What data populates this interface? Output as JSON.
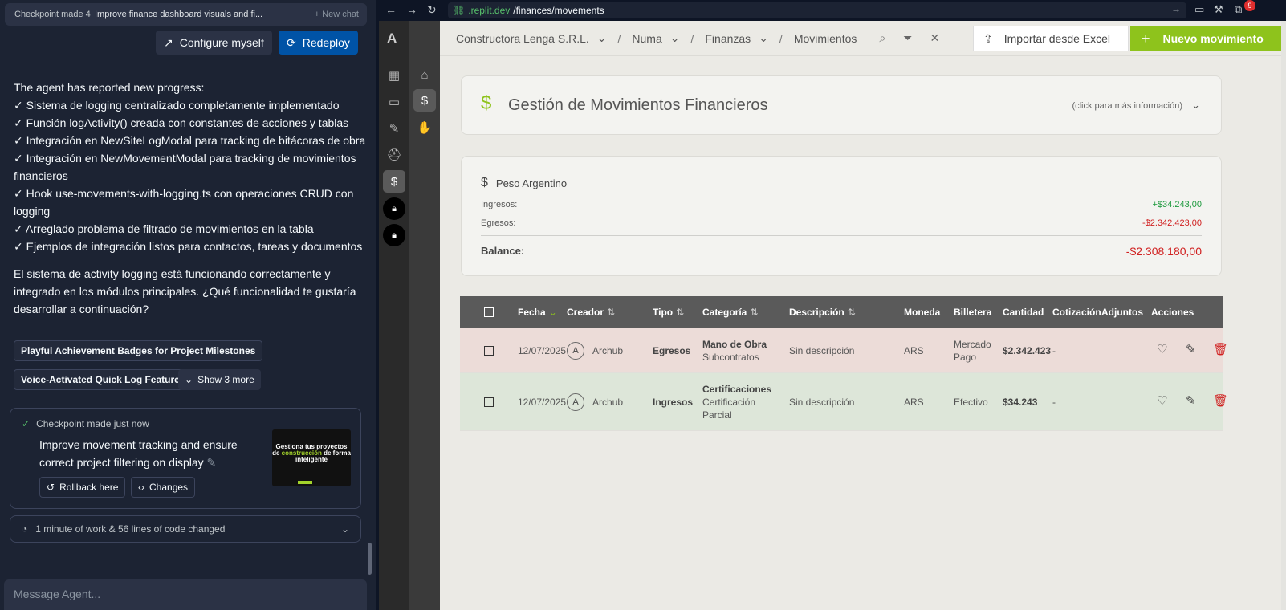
{
  "chat": {
    "top_tab_1": "Checkpoint made 4",
    "top_tab_2": "Improve finance dashboard visuals and fi...",
    "new_chat": "+ New chat",
    "configure_label": "Configure myself",
    "redeploy_label": "Redeploy",
    "agent_intro": "The agent has reported new progress:",
    "progress_items": [
      "✓ Sistema de logging centralizado completamente implementado",
      "✓ Función logActivity() creada con constantes de acciones y tablas",
      "✓ Integración en NewSiteLogModal para tracking de bitácoras de obra",
      "✓ Integración en NewMovementModal para tracking de movimientos financieros",
      "✓ Hook use-movements-with-logging.ts con operaciones CRUD con logging",
      "✓ Arreglado problema de filtrado de movimientos en la tabla",
      "✓ Ejemplos de integración listos para contactos, tareas y documentos"
    ],
    "summary": "El sistema de activity logging está funcionando correctamente y integrado en los módulos principales. ¿Qué funcionalidad te gustaría desarrollar a continuación?",
    "suggestions": [
      "Playful Achievement Badges for Project Milestones",
      "Voice-Activated Quick Log Feature"
    ],
    "show_more": "Show 3 more",
    "checkpoint": {
      "header": "Checkpoint made just now",
      "title": "Improve movement tracking and ensure correct project filtering on display",
      "rollback": "Rollback here",
      "changes": "Changes",
      "thumb_text_a": "Gestiona tus proyectos de",
      "thumb_text_accent": "construcción",
      "thumb_text_b": "de forma inteligente"
    },
    "work_summary": "1 minute of work & 56 lines of code changed",
    "input_placeholder": "Message Agent..."
  },
  "browser": {
    "url_domain": ".replit.dev",
    "url_path": "/finances/movements",
    "notif_count": "9"
  },
  "app": {
    "logo": "A",
    "breadcrumb": [
      "Constructora Lenga S.R.L.",
      "Numa",
      "Finanzas",
      "Movimientos"
    ],
    "import_label": "Importar desde Excel",
    "new_label": "Nuevo movimiento",
    "info_title": "Gestión de Movimientos Financieros",
    "info_hint": "(click para más información)",
    "currency": {
      "name": "Peso Argentino",
      "ingresos_label": "Ingresos:",
      "ingresos_value": "+$34.243,00",
      "egresos_label": "Egresos:",
      "egresos_value": "-$2.342.423,00",
      "balance_label": "Balance:",
      "balance_value": "-$2.308.180,00"
    },
    "table": {
      "headers": [
        "Fecha",
        "Creador",
        "Tipo",
        "Categoría",
        "Descripción",
        "Moneda",
        "Billetera",
        "Cantidad",
        "Cotización",
        "Adjuntos",
        "Acciones"
      ],
      "rows": [
        {
          "fecha": "12/07/2025",
          "avatar": "A",
          "creador": "Archub",
          "tipo": "Egresos",
          "categoria": "Mano de Obra",
          "subcategoria": "Subcontratos",
          "descripcion": "Sin descripción",
          "moneda": "ARS",
          "billetera": "Mercado Pago",
          "cantidad": "$2.342.423",
          "cotizacion": "-"
        },
        {
          "fecha": "12/07/2025",
          "avatar": "A",
          "creador": "Archub",
          "tipo": "Ingresos",
          "categoria": "Certificaciones",
          "subcategoria": "Certificación Parcial",
          "descripcion": "Sin descripción",
          "moneda": "ARS",
          "billetera": "Efectivo",
          "cantidad": "$34.243",
          "cotizacion": "-"
        }
      ]
    }
  }
}
